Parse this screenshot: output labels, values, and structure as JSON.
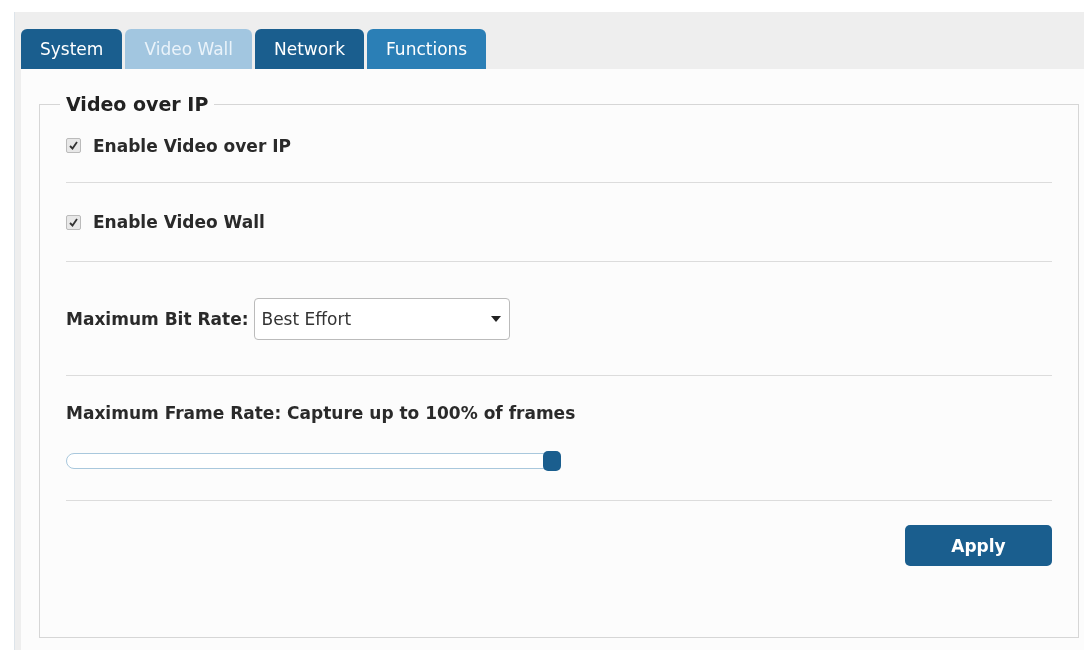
{
  "tabs": [
    {
      "label": "System",
      "selected": false,
      "hovered": false
    },
    {
      "label": "Video Wall",
      "selected": true,
      "hovered": false
    },
    {
      "label": "Network",
      "selected": false,
      "hovered": false
    },
    {
      "label": "Functions",
      "selected": false,
      "hovered": true
    }
  ],
  "section": {
    "legend": "Video over IP",
    "options": [
      {
        "label": "Enable Video over IP",
        "checked": true
      },
      {
        "label": "Enable Video Wall",
        "checked": true
      }
    ],
    "bit_rate": {
      "label": "Maximum Bit Rate:",
      "value": "Best Effort"
    },
    "frame_rate": {
      "label": "Maximum Frame Rate: Capture up to 100% of frames",
      "level": 1.0
    },
    "apply_button": "Apply"
  }
}
